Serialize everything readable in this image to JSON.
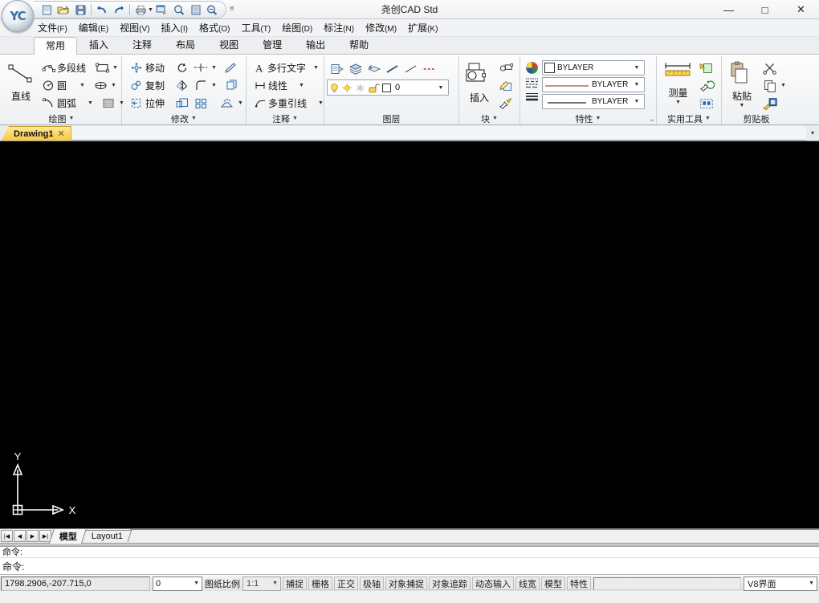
{
  "window": {
    "title": "尧创CAD Std",
    "minimize_label": "—",
    "maximize_label": "□",
    "close_label": "✕",
    "orb_label": "YC"
  },
  "quick_access": {
    "more_label": "⩸",
    "buttons": [
      {
        "name": "new-file-icon",
        "tooltip": "新建"
      },
      {
        "name": "open-file-icon",
        "tooltip": "打开"
      },
      {
        "name": "save-icon",
        "tooltip": "保存"
      },
      {
        "name": "undo-icon",
        "tooltip": "放弃"
      },
      {
        "name": "redo-icon",
        "tooltip": "重做"
      },
      {
        "name": "print-icon",
        "tooltip": "打印"
      },
      {
        "name": "plot-preview-icon",
        "tooltip": "打印预览"
      },
      {
        "name": "zoom-icon",
        "tooltip": "缩放"
      },
      {
        "name": "page-setup-icon",
        "tooltip": "页面设置"
      },
      {
        "name": "zoom-window-icon",
        "tooltip": "窗口缩放"
      }
    ]
  },
  "menubar": [
    {
      "label": "文件",
      "mnemonic": "(F)"
    },
    {
      "label": "编辑",
      "mnemonic": "(E)"
    },
    {
      "label": "视图",
      "mnemonic": "(V)"
    },
    {
      "label": "插入",
      "mnemonic": "(I)"
    },
    {
      "label": "格式",
      "mnemonic": "(O)"
    },
    {
      "label": "工具",
      "mnemonic": "(T)"
    },
    {
      "label": "绘图",
      "mnemonic": "(D)"
    },
    {
      "label": "标注",
      "mnemonic": "(N)"
    },
    {
      "label": "修改",
      "mnemonic": "(M)"
    },
    {
      "label": "扩展",
      "mnemonic": "(K)"
    }
  ],
  "ribbon_tabs": [
    {
      "label": "常用",
      "active": true
    },
    {
      "label": "插入",
      "active": false
    },
    {
      "label": "注释",
      "active": false
    },
    {
      "label": "布局",
      "active": false
    },
    {
      "label": "视图",
      "active": false
    },
    {
      "label": "管理",
      "active": false
    },
    {
      "label": "输出",
      "active": false
    },
    {
      "label": "帮助",
      "active": false
    }
  ],
  "panels": {
    "draw": {
      "title": "绘图",
      "big_button": "直线",
      "items": [
        {
          "label": "多段线",
          "icon": "polyline-icon"
        },
        {
          "label": "圆",
          "icon": "circle-icon"
        },
        {
          "label": "圆弧",
          "icon": "arc-icon"
        },
        {
          "label": "",
          "icon": "rectangle-icon"
        },
        {
          "label": "",
          "icon": "ellipse-icon"
        },
        {
          "label": "",
          "icon": "hatch-icon"
        }
      ]
    },
    "modify": {
      "title": "修改",
      "items": [
        {
          "label": "移动",
          "icon": "move-icon"
        },
        {
          "label": "复制",
          "icon": "copy-icon"
        },
        {
          "label": "拉伸",
          "icon": "stretch-icon"
        },
        {
          "label": "",
          "icon": "rotate-icon"
        },
        {
          "label": "",
          "icon": "mirror-icon"
        },
        {
          "label": "",
          "icon": "scale-icon"
        },
        {
          "label": "",
          "icon": "trim-icon"
        },
        {
          "label": "",
          "icon": "fillet-icon"
        },
        {
          "label": "",
          "icon": "array-icon"
        },
        {
          "label": "",
          "icon": "erase-icon"
        },
        {
          "label": "",
          "icon": "offset-icon"
        },
        {
          "label": "",
          "icon": "explode-icon"
        }
      ]
    },
    "annotation": {
      "title": "注释",
      "items": [
        {
          "label": "多行文字",
          "icon": "multiline-text-icon"
        },
        {
          "label": "线性",
          "icon": "linear-dimension-icon"
        },
        {
          "label": "多重引线",
          "icon": "multileader-icon"
        }
      ]
    },
    "layer": {
      "title": "图层",
      "top_icons": [
        {
          "name": "layer-properties-icon"
        },
        {
          "name": "layer-manager-icon"
        },
        {
          "name": "layer-previous-icon"
        },
        {
          "name": "layer-line-solid-icon"
        },
        {
          "name": "layer-line-thin-icon"
        },
        {
          "name": "layer-line-dashed-icon"
        }
      ],
      "current_layer": "0",
      "state_icons": [
        {
          "name": "layer-on-bulb-icon"
        },
        {
          "name": "layer-thaw-sun-icon"
        },
        {
          "name": "layer-freeze-icon"
        },
        {
          "name": "layer-unlock-icon"
        }
      ]
    },
    "block": {
      "title": "块",
      "big_button": "插入",
      "items": [
        {
          "label": "",
          "icon": "create-block-icon"
        },
        {
          "label": "",
          "icon": "edit-attribute-icon"
        },
        {
          "label": "",
          "icon": "define-attribute-icon"
        }
      ]
    },
    "properties": {
      "title": "特性",
      "color": "BYLAYER",
      "linetype": "BYLAYER",
      "lineweight": "BYLAYER",
      "icons": [
        {
          "name": "color-wheel-icon"
        },
        {
          "name": "linetype-icon"
        },
        {
          "name": "lineweight-icon"
        }
      ]
    },
    "utilities": {
      "title": "实用工具",
      "big_button": "测量",
      "items": [
        {
          "label": "",
          "icon": "quick-select-icon"
        },
        {
          "label": "",
          "icon": "select-similar-icon"
        },
        {
          "label": "",
          "icon": "select-all-icon"
        }
      ]
    },
    "clipboard": {
      "title": "剪贴板",
      "big_button": "粘贴",
      "items": [
        {
          "label": "",
          "icon": "cut-scissors-icon"
        },
        {
          "label": "",
          "icon": "copy-clip-icon"
        },
        {
          "label": "",
          "icon": "match-properties-icon"
        }
      ]
    }
  },
  "document_tabs": [
    {
      "label": "Drawing1",
      "close": "✕",
      "active": true
    }
  ],
  "doctab_overflow": "▾",
  "layout": {
    "nav": [
      "|◀",
      "◀",
      "▶",
      "▶|"
    ],
    "tabs": [
      {
        "label": "模型",
        "active": true
      },
      {
        "label": "Layout1",
        "active": false
      }
    ]
  },
  "command": {
    "history": "命令:",
    "prompt": "命令:",
    "input": ""
  },
  "statusbar": {
    "coordinates": "1798.2906,-207.715,0",
    "layer_combo": "0",
    "scale_label": "图纸比例",
    "scale_value": "1:1",
    "toggles": [
      {
        "label": "捕捉",
        "active": false
      },
      {
        "label": "栅格",
        "active": false
      },
      {
        "label": "正交",
        "active": false
      },
      {
        "label": "极轴",
        "active": false
      },
      {
        "label": "对象捕捉",
        "active": false
      },
      {
        "label": "对象追踪",
        "active": false
      },
      {
        "label": "动态输入",
        "active": false
      },
      {
        "label": "线宽",
        "active": false
      },
      {
        "label": "模型",
        "active": false
      },
      {
        "label": "特性",
        "active": false
      }
    ],
    "filler_text": "",
    "ui_mode": "V8界面"
  },
  "canvas": {
    "background_color": "#000000",
    "ucs_x_label": "X",
    "ucs_y_label": "Y"
  },
  "colors": {
    "accent_tab": "#f6c944",
    "ribbon_bg": "#f2f3f5",
    "canvas": "#000000",
    "hover": "#d7e8fb"
  }
}
